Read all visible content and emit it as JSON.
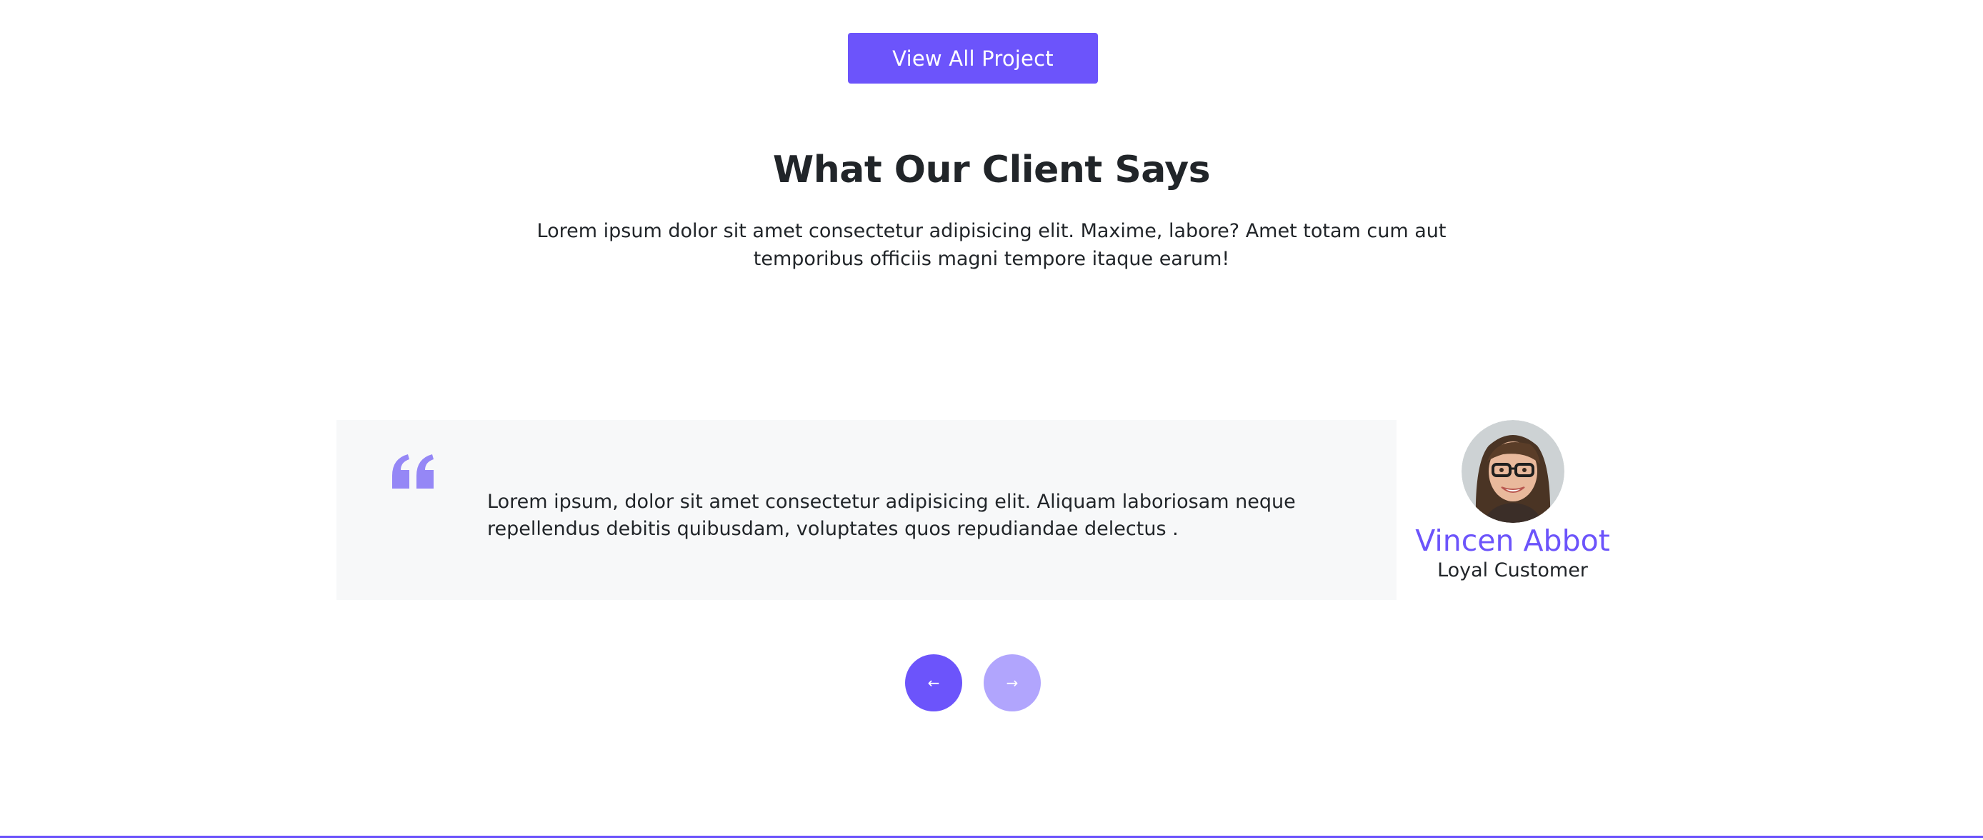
{
  "header": {
    "view_all_label": "View All Project"
  },
  "section": {
    "title": "What Our Client Says",
    "subtitle": "Lorem ipsum dolor sit amet consectetur adipisicing elit. Maxime, labore? Amet totam cum aut temporibus officiis magni tempore itaque earum!"
  },
  "testimonial": {
    "quote_icon": "quote-icon",
    "text": "Lorem ipsum, dolor sit amet consectetur adipisicing elit. Aliquam laboriosam neque repellendus debitis quibusdam, voluptates quos repudiandae delectus .",
    "author_name": "Vincen Abbot",
    "author_role": "Loyal Customer"
  },
  "navigation": {
    "prev_icon": "arrow-left-icon",
    "next_icon": "arrow-right-icon",
    "prev_glyph": "←",
    "next_glyph": "→"
  },
  "colors": {
    "accent": "#6c54fb",
    "accent_light": "#b1a5fd",
    "quote": "#9587f6",
    "card_bg": "#f7f8f9",
    "text": "#212529"
  }
}
